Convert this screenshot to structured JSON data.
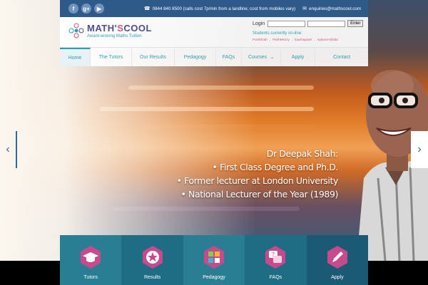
{
  "topbar": {
    "social": [
      "f",
      "g+",
      "▶"
    ],
    "phone": "0844 840 8500 (calls cost 7p/min from a landline; cost from mobiles vary)",
    "email": "enquiries@mathscool.com"
  },
  "logo": {
    "name_part1": "MATH'",
    "name_part2": "S",
    "name_part3": "COOL",
    "tagline": "Award-winning Maths Tuition"
  },
  "login": {
    "label": "Login",
    "button": "Enter",
    "online_title": "Students currently on-line:",
    "online_users": [
      "PunitShah",
      ",",
      "ParthMezzy",
      ",",
      "kayshapatel",
      ",",
      "ApdoneAbbida"
    ]
  },
  "nav": {
    "items": [
      {
        "label": "Home",
        "active": true
      },
      {
        "label": "The Tutors"
      },
      {
        "label": "Our Results"
      },
      {
        "label": "Pedagogy"
      },
      {
        "label": "FAQs"
      },
      {
        "label": "Courses"
      },
      {
        "label": "Apply"
      },
      {
        "label": "Contact"
      }
    ]
  },
  "slide": {
    "lines": [
      "Dr Deepak Shah:",
      "• First Class Degree and Ph.D.",
      "• Former lecturer at London University",
      "• National Lecturer of the Year (1989)"
    ]
  },
  "arrows": {
    "left": "‹",
    "right": "›"
  },
  "tiles": [
    {
      "label": "Tutors",
      "bg": "#2a7e93",
      "icon_color": "#c94a8c"
    },
    {
      "label": "Results",
      "bg": "#1f6d84",
      "icon_color": "#c94a8c"
    },
    {
      "label": "Pedagogy",
      "bg": "#2a7e93",
      "icon_color": "#c94a8c"
    },
    {
      "label": "FAQs",
      "bg": "#1f6d84",
      "icon_color": "#c94a8c"
    },
    {
      "label": "Apply",
      "bg": "#1a5a74",
      "icon_color": "#c94a8c"
    }
  ],
  "colors": {
    "accent": "#2b9fb4",
    "brand": "#4b4f8a",
    "pink": "#d0567f",
    "topbar": "#2e5a8a"
  }
}
